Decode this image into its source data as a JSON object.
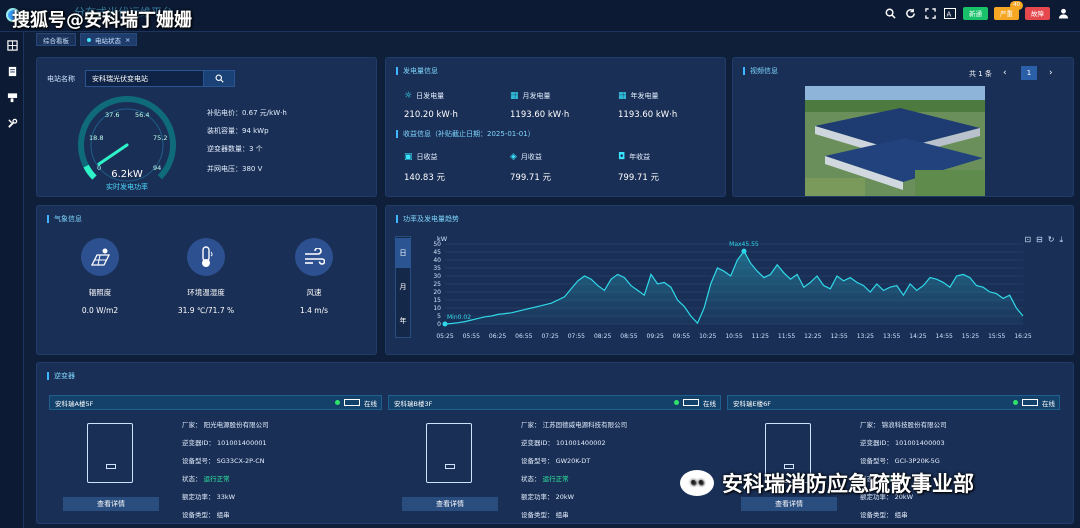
{
  "watermark": "搜狐号@安科瑞丁姗姗",
  "app_title": "分布式光伏运维平台",
  "toolbar": {
    "btn_new": "新通",
    "btn_serious": "严重",
    "btn_serious_count": "40",
    "btn_fault": "故障",
    "colors": {
      "new": "#19c26a",
      "serious": "#f5a623",
      "fault": "#e5484d"
    }
  },
  "tabs": [
    {
      "label": "综合看板"
    },
    {
      "label": "电站状态",
      "close": "×"
    }
  ],
  "station": {
    "label": "电站名称",
    "name": "安科瑞光伏变电站",
    "gauge_value": "6.2kW",
    "gauge_caption": "实时发电功率",
    "gauge_ticks": [
      "0",
      "18.8",
      "37.6",
      "56.4",
      "75.2",
      "94"
    ],
    "gauge_level": 0.066,
    "price": "补贴电价：0.67 元/kW·h",
    "capacity": "装机容量：94 kWp",
    "inverters": "逆变器数量：3 个",
    "voltage": "并网电压：380 V"
  },
  "generation": {
    "title": "发电量信息",
    "daily_label": "日发电量",
    "daily_value": "210.20 kW·h",
    "monthly_label": "月发电量",
    "monthly_value": "1193.60 kW·h",
    "yearly_label": "年发电量",
    "yearly_value": "1193.60 kW·h",
    "income_title": "收益信息（补贴截止日期：2025-01-01）",
    "daily_income_label": "日收益",
    "daily_income_value": "140.83 元",
    "monthly_income_label": "月收益",
    "monthly_income_value": "799.71 元",
    "yearly_income_label": "年收益",
    "yearly_income_value": "799.71 元"
  },
  "video": {
    "title": "视频信息",
    "total": "共 1 条",
    "page": "1"
  },
  "weather": {
    "title": "气象信息",
    "items": [
      {
        "label": "辐照度",
        "value": "0.0 W/m2"
      },
      {
        "label": "环境温湿度",
        "value": "31.9 ℃/71.7 %"
      },
      {
        "label": "风速",
        "value": "1.4 m/s"
      }
    ]
  },
  "trend": {
    "title": "功率及发电量趋势",
    "tabs": [
      "日",
      "月",
      "年"
    ],
    "ylabel": "kW",
    "max_label": "Max45.55",
    "min_label": "Min0.02"
  },
  "chart_data": {
    "type": "area",
    "ylabel": "kW",
    "ylim": [
      0,
      50
    ],
    "yticks": [
      0,
      5,
      10,
      15,
      20,
      25,
      30,
      35,
      40,
      45,
      50
    ],
    "x_ticks": [
      "05:25",
      "05:55",
      "06:25",
      "06:55",
      "07:25",
      "07:55",
      "08:25",
      "08:55",
      "09:25",
      "09:55",
      "10:25",
      "10:55",
      "11:25",
      "11:55",
      "12:25",
      "12:55",
      "13:25",
      "13:55",
      "14:25",
      "14:55",
      "15:25",
      "15:55",
      "16:25"
    ],
    "series": [
      {
        "values": [
          0.02,
          0.3,
          0.8,
          1.5,
          2.5,
          3.5,
          4.5,
          5,
          6,
          6.5,
          7,
          8,
          9,
          10,
          11,
          12,
          13,
          15,
          17,
          22,
          27,
          30,
          28,
          24,
          21,
          28,
          31,
          29,
          24,
          21,
          18,
          31,
          25,
          26,
          23,
          15,
          11,
          5,
          0.5,
          10,
          25,
          35,
          33,
          30,
          40,
          45.55,
          38,
          33,
          29,
          31,
          37,
          32,
          28,
          31,
          23,
          26,
          30,
          24,
          22,
          30,
          27,
          29,
          26,
          24,
          20,
          25,
          21,
          23,
          24,
          18,
          25,
          21,
          24,
          29,
          28,
          26,
          23,
          30,
          31,
          29,
          24,
          23,
          20,
          19,
          16,
          18,
          10,
          5
        ]
      }
    ]
  },
  "inverters": {
    "title": "逆变器",
    "status_label": "在线",
    "detail_btn": "查看详情",
    "cards": [
      {
        "name": "安科瑞A楼5F",
        "maker": "厂家：  阳光电源股份有限公司",
        "id": "逆变器ID：  101001400001",
        "model": "设备型号：  SG33CX-2P-CN",
        "state_label": "状态：",
        "state_value": "运行正常",
        "power": "额定功率：  33kW",
        "type": "设备类型：  组串"
      },
      {
        "name": "安科瑞B楼3F",
        "maker": "厂家：  江苏固德威电源科技有限公司",
        "id": "逆变器ID：  101001400002",
        "model": "设备型号：  GW20K-DT",
        "state_label": "状态：",
        "state_value": "运行正常",
        "power": "额定功率：  20kW",
        "type": "设备类型：  组串"
      },
      {
        "name": "安科瑞E楼6F",
        "maker": "厂家：  锦浪科技股份有限公司",
        "id": "逆变器ID：  101001400003",
        "model": "设备型号：  GCI-3P20K-5G",
        "state_label": "状态：",
        "state_value": "运行正常",
        "power": "额定功率：  20kW",
        "type": "设备类型：  组串"
      }
    ]
  },
  "wechat_watermark": "安科瑞消防应急疏散事业部"
}
